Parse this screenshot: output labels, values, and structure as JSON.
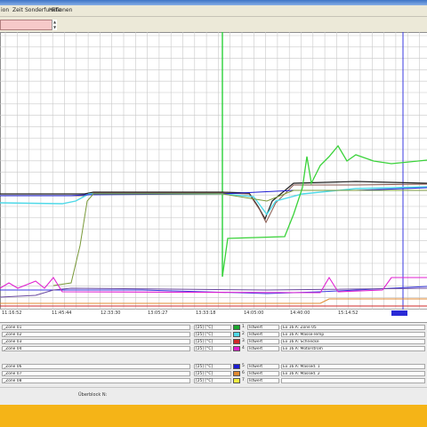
{
  "menu": [
    "ion",
    "Zeit",
    "Sonderfunktionen",
    "Hilfe"
  ],
  "xaxis_ticks": [
    "11:16:52",
    "11:45:44",
    "12:33:30",
    "13:05:27",
    "13:33:18",
    "14:05:00",
    "14:40:00",
    "15:14:52"
  ],
  "legend": [
    {
      "name": "_Zone 01",
      "unit": "[25] [°C]",
      "color": "#1aa82e",
      "num": "1",
      "kind": "Istwert",
      "source": "Ex 16.A: Zone 05"
    },
    {
      "name": "_Zone 02",
      "unit": "[25] [°C]",
      "color": "#4fd9e8",
      "num": "2",
      "kind": "Istwert",
      "source": "Ex 16.A: Masse-Temp"
    },
    {
      "name": "_Zone 03",
      "unit": "[25] [°C]",
      "color": "#d12a2a",
      "num": "3",
      "kind": "Istwert",
      "source": "Ex 16.A: Schnecke"
    },
    {
      "name": "_Zone 04",
      "unit": "[25] [°C]",
      "color": "#e020d0",
      "num": "4",
      "kind": "Istwert",
      "source": "Ex 16.A: Motorstrom"
    },
    {
      "name": "",
      "unit": "",
      "color": "",
      "num": "",
      "kind": "",
      "source": ""
    },
    {
      "name": "_Zone 06",
      "unit": "[25] [°C]",
      "color": "#1d1dd4",
      "num": "5",
      "kind": "Istwert",
      "source": "Ex 16.A: Massed. 1"
    },
    {
      "name": "_Zone 07",
      "unit": "[25] [°C]",
      "color": "#e08a30",
      "num": "6",
      "kind": "Istwert",
      "source": "Ex 16.A: Massed. 2"
    },
    {
      "name": "_Zone 08",
      "unit": "[25] [°C]",
      "color": "#f0ec40",
      "num": "7",
      "kind": "Istwert",
      "source": ""
    }
  ],
  "status": {
    "text": "Überblock N:"
  }
}
